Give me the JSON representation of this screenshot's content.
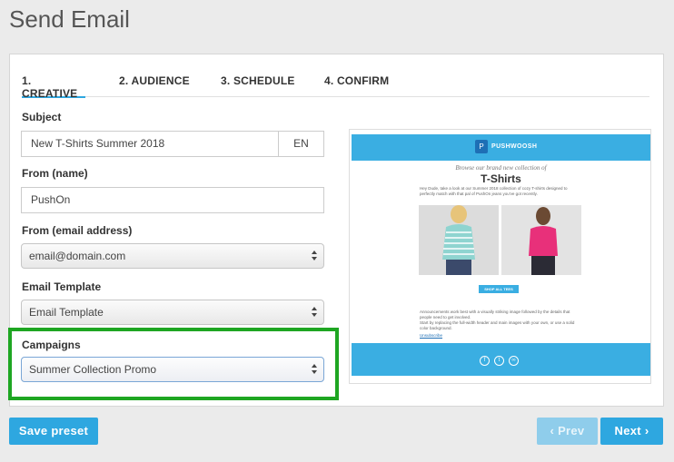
{
  "page": {
    "title": "Send Email"
  },
  "tabs": [
    {
      "label": "1. CREATIVE"
    },
    {
      "label": "2. AUDIENCE"
    },
    {
      "label": "3. SCHEDULE"
    },
    {
      "label": "4. CONFIRM"
    }
  ],
  "form": {
    "subject": {
      "label": "Subject",
      "value": "New T-Shirts Summer 2018",
      "lang": "EN"
    },
    "from_name": {
      "label": "From (name)",
      "value": "PushOn"
    },
    "from_email": {
      "label": "From (email address)",
      "selected": "email@domain.com"
    },
    "template": {
      "label": "Email Template",
      "selected": "Email Template"
    },
    "campaigns": {
      "label": "Campaigns",
      "selected": "Summer Collection Promo"
    }
  },
  "preview": {
    "brand": "PUSHWOOSH",
    "subtitle": "Browse our brand new collection of",
    "title": "T-Shirts",
    "intro": "Hey Dude, take a look at our Summer 2018 collection of cozy T-shirts designed to perfectly match with that pal of PushOn jeans you've got recently.",
    "cta": "SHOP ALL TEES",
    "body1": "Announcements work best with a visually striking image followed by the details that people need to get involved.",
    "body2": "Start by replacing the full-width header and main images with your own, or use a solid color background.",
    "unsubscribe": "Unsubscribe",
    "accent_color": "#3aaee2"
  },
  "buttons": {
    "save_preset": "Save preset",
    "prev": "‹ Prev",
    "next": "Next ›"
  },
  "colors": {
    "primary": "#2ea7e0",
    "highlight": "#1ea622"
  }
}
